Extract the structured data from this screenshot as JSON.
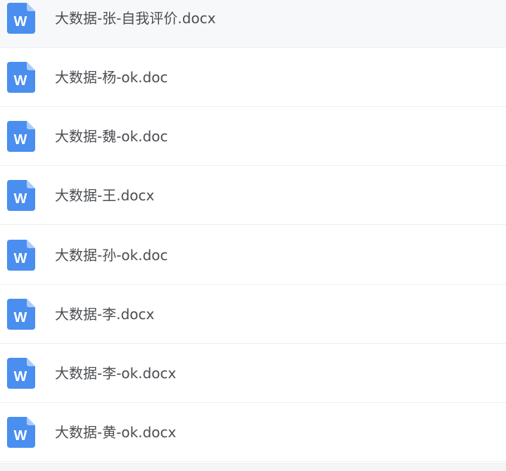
{
  "file_list": {
    "icon": "word-document-icon",
    "icon_color": "#4a8ef0",
    "icon_letter": "W",
    "files": [
      {
        "name": "大数据-张-自我评价.docx"
      },
      {
        "name": "大数据-杨-ok.doc"
      },
      {
        "name": "大数据-魏-ok.doc"
      },
      {
        "name": "大数据-王.docx"
      },
      {
        "name": "大数据-孙-ok.doc"
      },
      {
        "name": "大数据-李.docx"
      },
      {
        "name": "大数据-李-ok.docx"
      },
      {
        "name": "大数据-黄-ok.docx"
      }
    ]
  }
}
